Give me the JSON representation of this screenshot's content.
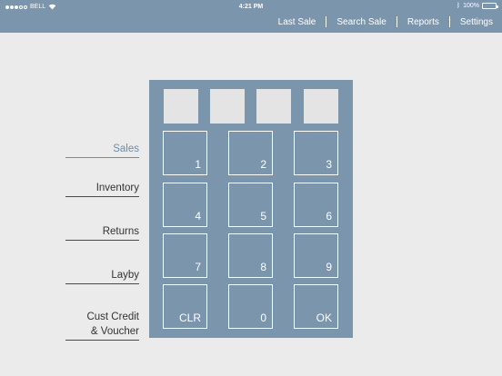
{
  "status_bar": {
    "carrier": "BELL",
    "time": "4:21 PM",
    "battery": "100%"
  },
  "nav": {
    "items": [
      "Last Sale",
      "Search Sale",
      "Reports",
      "Settings"
    ]
  },
  "menu": {
    "items": [
      {
        "label": "Sales",
        "active": true
      },
      {
        "label": "Inventory"
      },
      {
        "label": "Returns"
      },
      {
        "label": "Layby"
      },
      {
        "label_line1": "Cust Credit",
        "label_line2": "& Voucher"
      }
    ]
  },
  "keypad": {
    "keys": [
      "1",
      "2",
      "3",
      "4",
      "5",
      "6",
      "7",
      "8",
      "9",
      "CLR",
      "0",
      "OK"
    ]
  },
  "colors": {
    "accent": "#7b95ad",
    "active_menu": "#6b8cae",
    "background": "#ebebeb"
  }
}
